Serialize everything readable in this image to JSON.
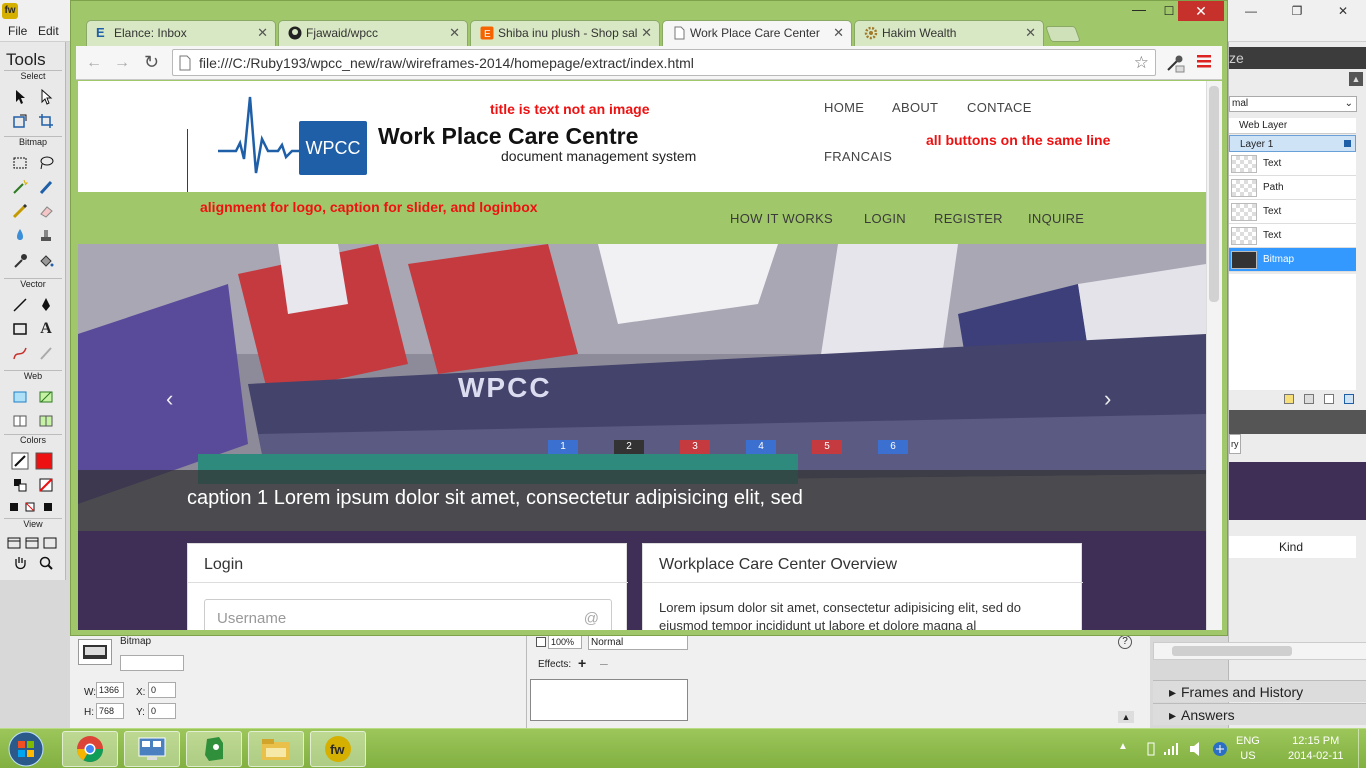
{
  "app": {
    "menu": [
      "File",
      "Edit"
    ],
    "tools_title": "Tools",
    "tool_sections": [
      "Select",
      "Bitmap",
      "Vector",
      "Web",
      "Colors",
      "View"
    ],
    "right_panel": {
      "title_fragment": "ze",
      "blend_mode": "mal",
      "web_layer": "Web Layer",
      "layer_name": "Layer 1",
      "layers": [
        "Text",
        "Path",
        "Text",
        "Text",
        "Bitmap"
      ],
      "library_tab": "ry",
      "kind_header": "Kind",
      "frames_history": "Frames and History",
      "answers": "Answers"
    },
    "properties": {
      "object_type": "Bitmap",
      "w_label": "W:",
      "w_value": "1366",
      "h_label": "H:",
      "h_value": "768",
      "x_label": "X:",
      "x_value": "0",
      "y_label": "Y:",
      "y_value": "0",
      "opacity": "100%",
      "blend": "Normal",
      "effects_label": "Effects:"
    }
  },
  "browser": {
    "tabs": [
      {
        "label": "Elance: Inbox",
        "icon": "elance-icon"
      },
      {
        "label": "Fjawaid/wpcc",
        "icon": "github-icon"
      },
      {
        "label": "Shiba inu plush - Shop sal",
        "icon": "shop-icon"
      },
      {
        "label": "Work Place Care Center",
        "icon": "page-icon"
      },
      {
        "label": "Hakim Wealth",
        "icon": "settings-icon"
      }
    ],
    "url": "file:///C:/Ruby193/wpcc_new/raw/wireframes-2014/homepage/extract/index.html"
  },
  "page": {
    "logo_text": "WPCC",
    "title": "Work Place Care Centre",
    "subtitle": "document management system",
    "notes": {
      "title": "title is text not an image",
      "buttons": "all buttons on the same line",
      "alignment": "alignment for logo, caption for slider, and loginbox"
    },
    "nav_top": [
      "HOME",
      "ABOUT",
      "CONTACE",
      "FRANCAIS"
    ],
    "nav_bottom": [
      "HOW IT WORKS",
      "LOGIN",
      "REGISTER",
      "INQUIRE"
    ],
    "slider": {
      "caption": "caption 1 Lorem ipsum dolor sit amet, consectetur adipisicing elit, sed",
      "banner_text": "WPCC",
      "card_letters": [
        "1",
        "2",
        "3",
        "4",
        "5",
        "6"
      ]
    },
    "login": {
      "title": "Login",
      "username_placeholder": "Username",
      "at_symbol": "@"
    },
    "overview": {
      "title": "Workplace Care Center Overview",
      "text": "Lorem ipsum dolor sit amet, consectetur adipisicing elit, sed do eiusmod tempor incididunt ut labore et dolore magna al"
    }
  },
  "taskbar": {
    "lang_line1": "ENG",
    "lang_line2": "US",
    "time": "12:15 PM",
    "date": "2014-02-11"
  },
  "colors": {
    "accent_green": "#a0c86a",
    "note_red": "#ee1111",
    "logo_blue": "#1f5fa8",
    "footer_purple": "#3f2e55"
  }
}
